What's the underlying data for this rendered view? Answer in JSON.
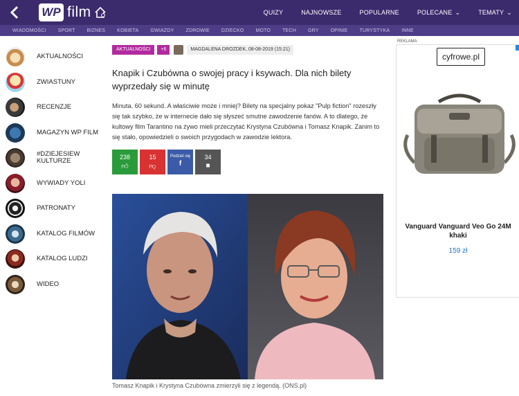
{
  "header": {
    "logo_mark": "WP",
    "logo_text": "film",
    "nav": [
      {
        "label": "QUIZY"
      },
      {
        "label": "NAJNOWSZE"
      },
      {
        "label": "POPULARNE"
      },
      {
        "label": "POLECANE",
        "dropdown": true
      },
      {
        "label": "TEMATY",
        "dropdown": true
      }
    ]
  },
  "categories": [
    "WIADOMOŚCI",
    "SPORT",
    "BIZNES",
    "KOBIETA",
    "GWIAZDY",
    "ZDROWIE",
    "DZIECKO",
    "MOTO",
    "TECH",
    "GRY",
    "OPINIE",
    "TURYSTYKA",
    "INNE"
  ],
  "sidebar": {
    "items": [
      {
        "label": "AKTUALNOŚCI"
      },
      {
        "label": "ZWIASTUNY"
      },
      {
        "label": "RECENZJE"
      },
      {
        "label": "MAGAZYN WP FILM"
      },
      {
        "label": "#DZIEJESIEW KULTURZE"
      },
      {
        "label": "WYWIADY YOLI"
      },
      {
        "label": "PATRONATY"
      },
      {
        "label": "KATALOG FILMÓW"
      },
      {
        "label": "KATALOG LUDZI"
      },
      {
        "label": "WIDEO"
      }
    ]
  },
  "article": {
    "tag": "AKTUALNOŚCI",
    "tag_more": "+6",
    "author": "MAGDALENA DROZDEK, 08-08-2019 (15:21)",
    "headline": "Knapik i Czubówna o swojej pracy i ksywach. Dla nich bilety wyprzedały się w minutę",
    "lead": "Minuta. 60 sekund. A właściwie może i mniej? Bilety na specjalny pokaz \"Pulp fiction\" rozeszły się tak szybko, że w internecie dało się słyszeć smutne zawodzenie fanów. A to dlatego, że kultowy film Tarantino na żywo mieli przeczytać Krystyna Czubówna i Tomasz Knapik. Zanim to się stało, opowiedzieli o swoich przygodach w zawodzie lektora.",
    "votes": {
      "up": "238",
      "down": "15",
      "share_label": "Podziel się",
      "share_symbol": "f",
      "comments": "34"
    },
    "caption": "Tomasz Knapik i Krystyna Czubówna zmierzyli się z legendą. (ONS.pl)"
  },
  "ad": {
    "label": "REKLAMA",
    "brand": "cyfrowe.pl",
    "title": "Vanguard Vanguard Veo Go 24M khaki",
    "price": "159 zł"
  },
  "colors": {
    "header_bg": "#3b2b6d",
    "category_bg": "#4d3d86",
    "tag": "#b22aa0",
    "vote_up": "#2a9b3a",
    "vote_down": "#d83232",
    "share": "#3b5ba8",
    "price": "#1a73c8"
  }
}
